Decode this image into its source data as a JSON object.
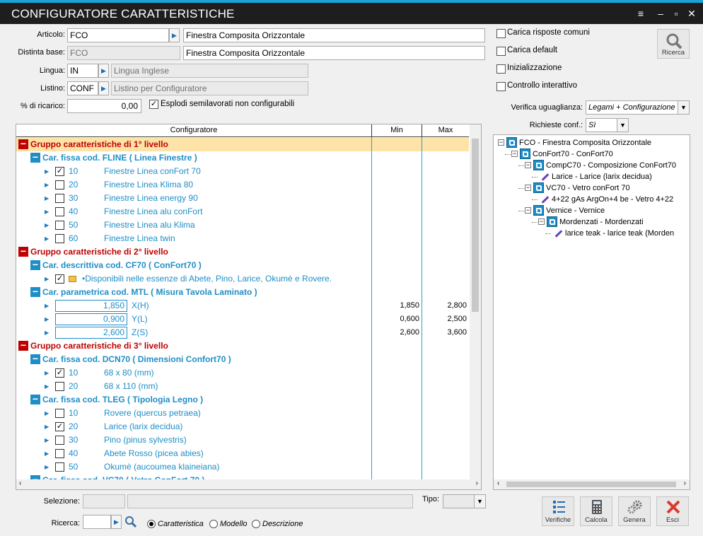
{
  "window": {
    "title": "CONFIGURATORE CARATTERISTICHE"
  },
  "form": {
    "articolo": {
      "label": "Articolo:",
      "code": "FCO",
      "desc": "Finestra Composita Orizzontale"
    },
    "distinta": {
      "label": "Distinta base:",
      "code": "FCO",
      "desc": "Finestra Composita Orizzontale"
    },
    "lingua": {
      "label": "Lingua:",
      "code": "IN",
      "desc": "Lingua Inglese"
    },
    "listino": {
      "label": "Listino:",
      "code": "CONF",
      "desc": "Listino per Configuratore"
    },
    "ricarico": {
      "label": "% di ricarico:",
      "value": "0,00"
    },
    "esplodi": {
      "label": "Esplodi semilavorati non configurabili",
      "checked": true
    }
  },
  "options": {
    "carica_risposte": {
      "label": "Carica risposte comuni",
      "checked": false
    },
    "carica_default": {
      "label": "Carica default",
      "checked": false
    },
    "inizializzazione": {
      "label": "Inizializzazione",
      "checked": false
    },
    "controllo": {
      "label": "Controllo interattivo",
      "checked": false
    },
    "ricerca_btn": "Ricerca",
    "verifica": {
      "label": "Verifica uguaglianza:",
      "value": "Legami + Configurazione"
    },
    "richieste": {
      "label": "Richieste conf.:",
      "value": "Sì"
    }
  },
  "grid": {
    "headers": {
      "conf": "Configuratore",
      "min": "Min",
      "max": "Max"
    },
    "rows": [
      {
        "type": "group",
        "text": "Gruppo caratteristiche di 1° livello"
      },
      {
        "type": "char",
        "text": "Car. fissa cod. FLINE ( Linea Finestre )"
      },
      {
        "type": "item",
        "checked": true,
        "code": "10",
        "desc": "Finestre Linea conFort 70"
      },
      {
        "type": "item",
        "checked": false,
        "code": "20",
        "desc": "Finestre Linea Klima 80"
      },
      {
        "type": "item",
        "checked": false,
        "code": "30",
        "desc": "Finestre Linea energy 90"
      },
      {
        "type": "item",
        "checked": false,
        "code": "40",
        "desc": "Finestre Linea alu conFort"
      },
      {
        "type": "item",
        "checked": false,
        "code": "50",
        "desc": "Finestre Linea alu Klima"
      },
      {
        "type": "item",
        "checked": false,
        "code": "60",
        "desc": "Finestre Linea twin"
      },
      {
        "type": "group",
        "text": "Gruppo caratteristiche di 2° livello"
      },
      {
        "type": "char",
        "text": "Car. descrittiva cod. CF70 ( ConFort70 )"
      },
      {
        "type": "note",
        "checked": true,
        "desc": "•Disponibili nelle essenze di Abete, Pino, Larice, Okumè e Rovere."
      },
      {
        "type": "char",
        "text": "Car. parametrica cod. MTL ( Misura Tavola Laminato )"
      },
      {
        "type": "param",
        "value": "1,850",
        "name": "X(H)",
        "min": "1,850",
        "max": "2,800"
      },
      {
        "type": "param",
        "value": "0,900",
        "name": "Y(L)",
        "min": "0,600",
        "max": "2,500"
      },
      {
        "type": "param",
        "value": "2,600",
        "name": "Z(S)",
        "min": "2,600",
        "max": "3,600"
      },
      {
        "type": "group",
        "text": "Gruppo caratteristiche di 3° livello"
      },
      {
        "type": "char",
        "text": "Car. fissa cod. DCN70 ( Dimensioni Confort70 )"
      },
      {
        "type": "item",
        "checked": true,
        "code": "10",
        "desc": "68 x 80 (mm)"
      },
      {
        "type": "item",
        "checked": false,
        "code": "20",
        "desc": "68 x 110 (mm)"
      },
      {
        "type": "char",
        "text": "Car. fissa cod. TLEG ( Tipologia Legno )"
      },
      {
        "type": "item",
        "checked": false,
        "code": "10",
        "desc": "Rovere (quercus petraea)"
      },
      {
        "type": "item",
        "checked": true,
        "code": "20",
        "desc": "Larice (larix decidua)"
      },
      {
        "type": "item",
        "checked": false,
        "code": "30",
        "desc": "Pino (pinus sylvestris)"
      },
      {
        "type": "item",
        "checked": false,
        "code": "40",
        "desc": "Abete Rosso (picea abies)"
      },
      {
        "type": "item",
        "checked": false,
        "code": "50",
        "desc": "Okumè (aucoumea klaineiana)"
      },
      {
        "type": "char",
        "text": "Car. fissa cod. VC70 ( Vetro ConFort 70 )"
      }
    ]
  },
  "tree": {
    "nodes": [
      {
        "text": "FCO - Finestra Composita Orizzontale",
        "level": 0,
        "kind": "node"
      },
      {
        "text": "ConFort70 - ConFort70",
        "level": 1,
        "kind": "node"
      },
      {
        "text": "CompC70 - Composizione ConFort70",
        "level": 2,
        "kind": "node"
      },
      {
        "text": "Larice - Larice (larix decidua)",
        "level": 3,
        "kind": "leaf"
      },
      {
        "text": "VC70 - Vetro conFort 70",
        "level": 2,
        "kind": "node"
      },
      {
        "text": "4+22 gAs ArgOn+4 be - Vetro 4+22",
        "level": 3,
        "kind": "leaf"
      },
      {
        "text": "Vernice - Vernice",
        "level": 2,
        "kind": "node"
      },
      {
        "text": "Mordenzati - Mordenzati",
        "level": 3,
        "kind": "node"
      },
      {
        "text": "larice teak - larice teak (Morden",
        "level": 4,
        "kind": "leaf"
      }
    ]
  },
  "bottom": {
    "selezione": {
      "label": "Selezione:",
      "code": "",
      "desc": ""
    },
    "tipo": {
      "label": "Tipo:",
      "value": ""
    },
    "ricerca": {
      "label": "Ricerca:",
      "value": ""
    },
    "radios": [
      {
        "label": "Caratteristica",
        "selected": true
      },
      {
        "label": "Modello",
        "selected": false
      },
      {
        "label": "Descrizione",
        "selected": false
      }
    ],
    "buttons": {
      "verifiche": "Verifiche",
      "calcola": "Calcola",
      "genera": "Genera",
      "esci": "Esci"
    }
  },
  "colors": {
    "accent": "#1f8ec7",
    "group": "#c00000",
    "titlebar": "#1e1e1e",
    "highlight": "#fde3a7"
  }
}
